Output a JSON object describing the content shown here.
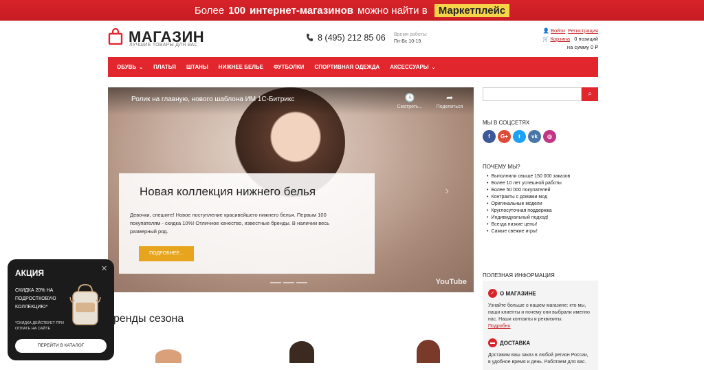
{
  "promo": {
    "prefix": "Более",
    "count": "100",
    "middle": "интернет-магазинов",
    "suffix": "можно найти в",
    "marketplace": "Маркетплейс"
  },
  "logo": {
    "title": "МАГАЗИН",
    "subtitle": "ЛУЧШИЕ ТОВАРЫ ДЛЯ ВАС"
  },
  "phone": "8 (495) 212 85 06",
  "hours": {
    "label": "Время работы:",
    "value": "Пн-Вс 10-19"
  },
  "account": {
    "login": "Войти",
    "register": "Регистрация",
    "cart": "Корзина",
    "cart_count": "0 позиций",
    "cart_total": "на сумму 0 ₽"
  },
  "nav": [
    {
      "label": "ОБУВЬ",
      "dropdown": true
    },
    {
      "label": "ПЛАТЬЯ",
      "dropdown": false
    },
    {
      "label": "ШТАНЫ",
      "dropdown": false
    },
    {
      "label": "НИЖНЕЕ БЕЛЬЕ",
      "dropdown": false
    },
    {
      "label": "ФУТБОЛКИ",
      "dropdown": false
    },
    {
      "label": "СПОРТИВНАЯ ОДЕЖДА",
      "dropdown": false
    },
    {
      "label": "АКСЕССУАРЫ",
      "dropdown": true
    }
  ],
  "video": {
    "title": "Ролик на главную, нового шаблона ИМ 1С-Битрикс",
    "watch_later": "Смотреть...",
    "share": "Поделиться",
    "brand": "YouTube"
  },
  "hero": {
    "heading": "Новая коллекция нижнего белья",
    "text": "Девочки, спешите! Новое поступление красивейшего нижнего белья. Первым 100 покупателям - скидка 10%! Отличное качество, известные бренды. В наличии весь размерный ряд.",
    "button": "ПОДРОБНЕЕ..."
  },
  "brands_title": "ренды сезона",
  "sidebar": {
    "social_title": "МЫ В СОЦСЕТЯХ",
    "social": [
      {
        "name": "facebook",
        "glyph": "f",
        "color": "#3b5998"
      },
      {
        "name": "google-plus",
        "glyph": "G+",
        "color": "#dd4b39"
      },
      {
        "name": "twitter",
        "glyph": "t",
        "color": "#1da1f2"
      },
      {
        "name": "vk",
        "glyph": "vk",
        "color": "#4a76a8"
      },
      {
        "name": "instagram",
        "glyph": "◎",
        "color": "#c13584"
      }
    ],
    "why_title": "ПОЧЕМУ МЫ?",
    "why": [
      "Выполнили свыше 150 000 заказов",
      "Более 10 лет успешной работы",
      "Более 50 000 покупателей",
      "Контракты с домами мод",
      "Оригинальные модели",
      "Круглосуточная поддержка",
      "Индивидуальный подход!",
      "Всегда низкие цены!",
      "Самые свежие игры!"
    ],
    "useful_title": "ПОЛЕЗНАЯ ИНФОРМАЦИЯ",
    "about_title": "О МАГАЗИНЕ",
    "about_text": "Узнайте больше о нашем магазине: кто мы, наши клиенты и почему они выбрали именно нас. Наши контакты и реквизиты.",
    "about_link": "Подробно",
    "delivery_title": "ДОСТАВКА",
    "delivery_text": "Доставим ваш заказ в любой регион России, в удобное время и день. Работаем для вас."
  },
  "popup": {
    "title": "АКЦИЯ",
    "text": "СКИДКА 20% НА ПОДРОСТКОВУЮ КОЛЛЕКЦИЮ*",
    "note": "*СКИДКА ДЕЙСТВУЕТ ПРИ ОПЛАТЕ НА САЙТЕ",
    "button": "ПЕРЕЙТИ В КАТАЛОГ"
  }
}
